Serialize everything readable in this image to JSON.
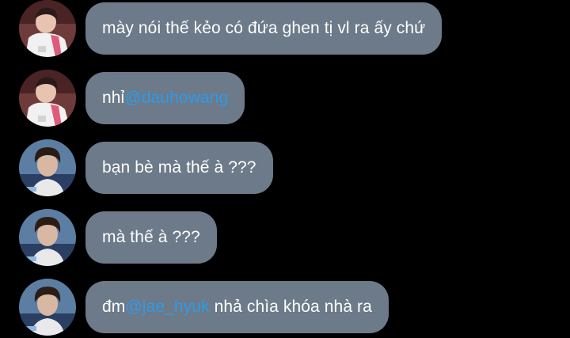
{
  "messages": [
    {
      "sender_avatar": "avatar-white-jacket",
      "parts": [
        {
          "text": "mày nói thế kẻo có đứa ghen tị vl ra ấy chứ",
          "mention": false
        }
      ]
    },
    {
      "sender_avatar": "avatar-white-jacket",
      "parts": [
        {
          "text": "nhỉ ",
          "mention": false
        },
        {
          "text": "@dauhowang",
          "mention": true
        }
      ]
    },
    {
      "sender_avatar": "avatar-dark-hair",
      "parts": [
        {
          "text": "bạn bè mà thế à ???",
          "mention": false
        }
      ]
    },
    {
      "sender_avatar": "avatar-dark-hair",
      "parts": [
        {
          "text": "mà thế à ???",
          "mention": false
        }
      ]
    },
    {
      "sender_avatar": "avatar-dark-hair",
      "parts": [
        {
          "text": "đm ",
          "mention": false
        },
        {
          "text": "@jae_hyuk",
          "mention": true
        },
        {
          "text": " nhả chìa khóa nhà ra",
          "mention": false
        }
      ]
    }
  ],
  "colors": {
    "background": "#000000",
    "bubble": "#6c7a89",
    "text": "#ffffff",
    "mention": "#2f9ae8"
  }
}
